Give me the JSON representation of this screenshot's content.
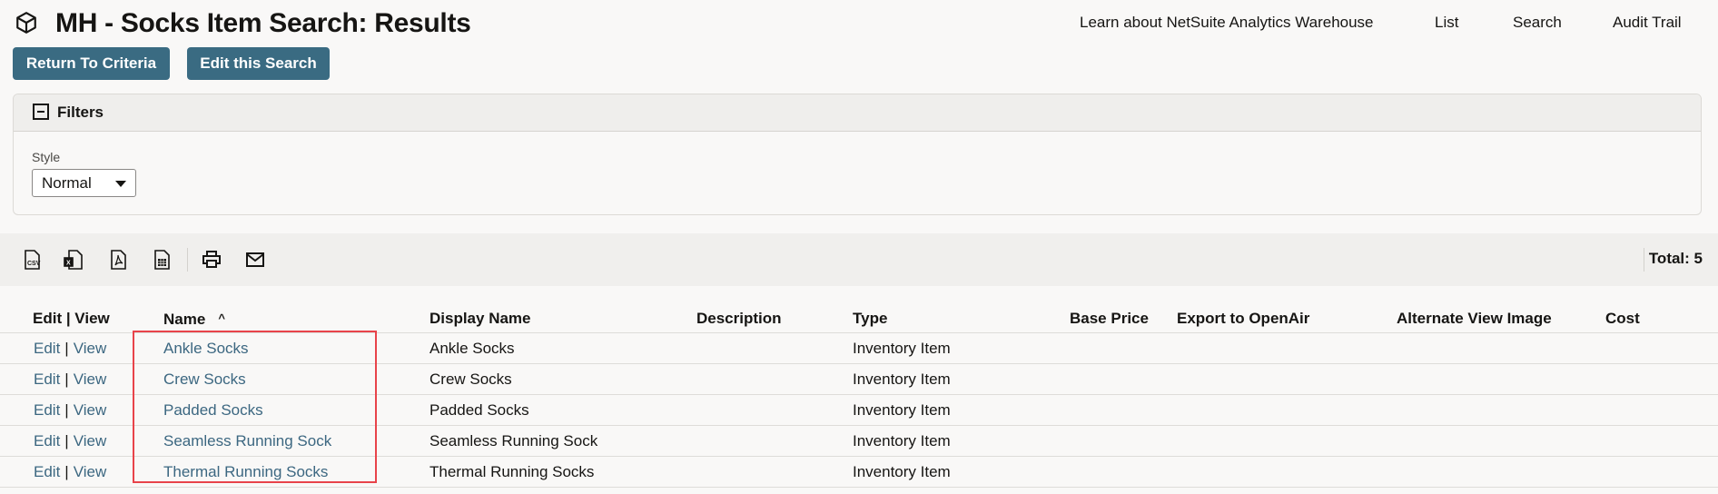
{
  "header": {
    "title": "MH - Socks Item Search: Results",
    "icon": "cube-icon",
    "links": [
      "Learn about NetSuite Analytics Warehouse",
      "List",
      "Search",
      "Audit Trail"
    ]
  },
  "buttons": {
    "return_to_criteria": "Return To Criteria",
    "edit_search": "Edit this Search"
  },
  "filters": {
    "title": "Filters",
    "style_label": "Style",
    "style_value": "Normal"
  },
  "toolbar": {
    "icons": [
      "csv-export-icon",
      "excel-export-icon",
      "pdf-export-icon",
      "spreadsheet-export-icon",
      "print-icon",
      "email-icon"
    ],
    "total": "Total: 5"
  },
  "table": {
    "columns": [
      "Edit | View",
      "Name",
      "Display Name",
      "Description",
      "Type",
      "Base Price",
      "Export to OpenAir",
      "Alternate View Image",
      "Cost"
    ],
    "sort_indicator": "^",
    "edit_label": "Edit",
    "view_label": "View",
    "separator": "|",
    "rows": [
      {
        "name": "Ankle Socks",
        "display_name": "Ankle Socks",
        "description": "",
        "type": "Inventory Item",
        "base_price": "",
        "export_openair": "",
        "alt_image": "",
        "cost": ""
      },
      {
        "name": "Crew Socks",
        "display_name": "Crew Socks",
        "description": "",
        "type": "Inventory Item",
        "base_price": "",
        "export_openair": "",
        "alt_image": "",
        "cost": ""
      },
      {
        "name": "Padded Socks",
        "display_name": "Padded Socks",
        "description": "",
        "type": "Inventory Item",
        "base_price": "",
        "export_openair": "",
        "alt_image": "",
        "cost": ""
      },
      {
        "name": "Seamless Running Sock",
        "display_name": "Seamless Running Sock",
        "description": "",
        "type": "Inventory Item",
        "base_price": "",
        "export_openair": "",
        "alt_image": "",
        "cost": ""
      },
      {
        "name": "Thermal Running Socks",
        "display_name": "Thermal Running Socks",
        "description": "",
        "type": "Inventory Item",
        "base_price": "",
        "export_openair": "",
        "alt_image": "",
        "cost": ""
      }
    ]
  },
  "highlight": {
    "color": "#e8434a"
  }
}
